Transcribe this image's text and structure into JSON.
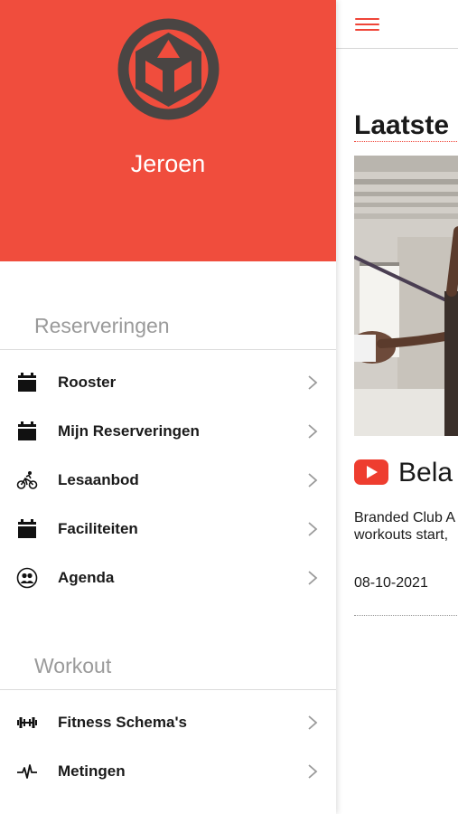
{
  "drawer": {
    "user_name": "Jeroen",
    "colors": {
      "header_bg": "#f04d3d",
      "logo_dark": "#4a4543"
    },
    "groups": [
      {
        "label": "Reserveringen",
        "items": [
          {
            "label": "Rooster",
            "icon": "calendar-icon"
          },
          {
            "label": "Mijn Reserveringen",
            "icon": "calendar-icon"
          },
          {
            "label": "Lesaanbod",
            "icon": "bicycle-icon"
          },
          {
            "label": "Faciliteiten",
            "icon": "calendar-icon"
          },
          {
            "label": "Agenda",
            "icon": "group-icon"
          }
        ]
      },
      {
        "label": "Workout",
        "items": [
          {
            "label": "Fitness Schema's",
            "icon": "dumbbell-icon"
          },
          {
            "label": "Metingen",
            "icon": "heartbeat-icon"
          }
        ]
      }
    ]
  },
  "main": {
    "menu_icon": "hamburger-icon",
    "section_title": "Laatste",
    "video": {
      "icon": "youtube-icon",
      "title": "Bela",
      "description_line1": "Branded Club A",
      "description_line2": "workouts start,",
      "date": "08-10-2021"
    },
    "accent_color": "#ef4538"
  }
}
